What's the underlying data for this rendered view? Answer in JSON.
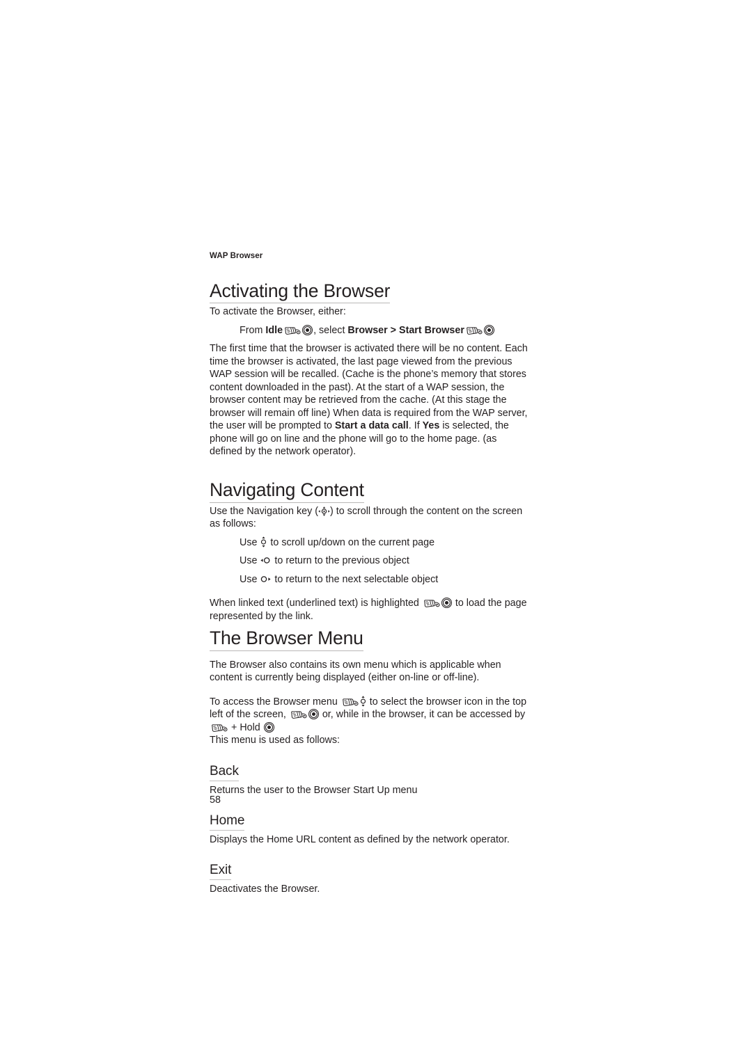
{
  "document": {
    "running_head": "WAP Browser",
    "page_number": "58"
  },
  "sections": {
    "activating": {
      "title": "Activating the Browser",
      "intro": "To activate the Browser, either:",
      "step_prefix": "From ",
      "step_idle": "Idle",
      "step_mid": ", select ",
      "step_browser": "Browser",
      "step_gt": " > ",
      "step_start_browser": "Start Browser",
      "paragraph_1": "The first time that the browser is activated there will be no content.  Each time the browser is activated, the last page viewed from the previous WAP session will be recalled. (Cache is the phone’s memory that stores content downloaded in the past). At the start of a WAP session, the browser content may be retrieved from the cache. (At this stage the browser will remain off line) When data is required from the WAP server, the user will be prompted to ",
      "paragraph_1_bold_1": "Start a data call",
      "paragraph_1_mid": ". If ",
      "paragraph_1_bold_2": "Yes",
      "paragraph_1_end": " is selected, the phone will go on line and the phone will go to the home page. (as defined by the network operator)."
    },
    "navigating": {
      "title": "Navigating Content",
      "intro_before": "Use the Navigation key (",
      "intro_after": ") to scroll through the content on the screen as follows:",
      "bullets": [
        {
          "before": "Use ",
          "after": " to scroll up/down on the current page",
          "icon": "nav-up-down-icon"
        },
        {
          "before": "Use ",
          "after": " to return to the previous object",
          "icon": "nav-left-icon"
        },
        {
          "before": "Use ",
          "after": " to return to the next selectable object",
          "icon": "nav-right-icon"
        }
      ],
      "closing_before": "When linked text (underlined text) is highlighted ",
      "closing_after": " to load the page represented by the link."
    },
    "browser_menu": {
      "title": "The Browser Menu",
      "paragraph_1": "The Browser also contains its own menu which is applicable when content is currently being displayed (either on-line or off-line).",
      "access_1": "To access the Browser menu ",
      "access_2": " to select the browser icon in the top left of the screen, ",
      "access_3": " or, while in the browser, it can be accessed by ",
      "access_4": " + Hold ",
      "menu_intro": "This menu is used as follows:",
      "items": [
        {
          "name": "Back",
          "description": "Returns the user to the Browser Start Up menu"
        },
        {
          "name": "Home",
          "description": "Displays the Home URL content as defined by the network operator."
        },
        {
          "name": "Exit",
          "description": "Deactivates the Browser."
        }
      ]
    }
  },
  "icons": {
    "softkey": "soft-key-icon",
    "select": "select-key-icon",
    "nav_up_down": "nav-up-down-icon",
    "nav_left": "nav-left-icon",
    "nav_right": "nav-right-icon",
    "nav_four_way": "nav-four-way-icon"
  },
  "colors": {
    "text": "#231f20",
    "rule": "#b9b7b6",
    "background": "#ffffff"
  }
}
